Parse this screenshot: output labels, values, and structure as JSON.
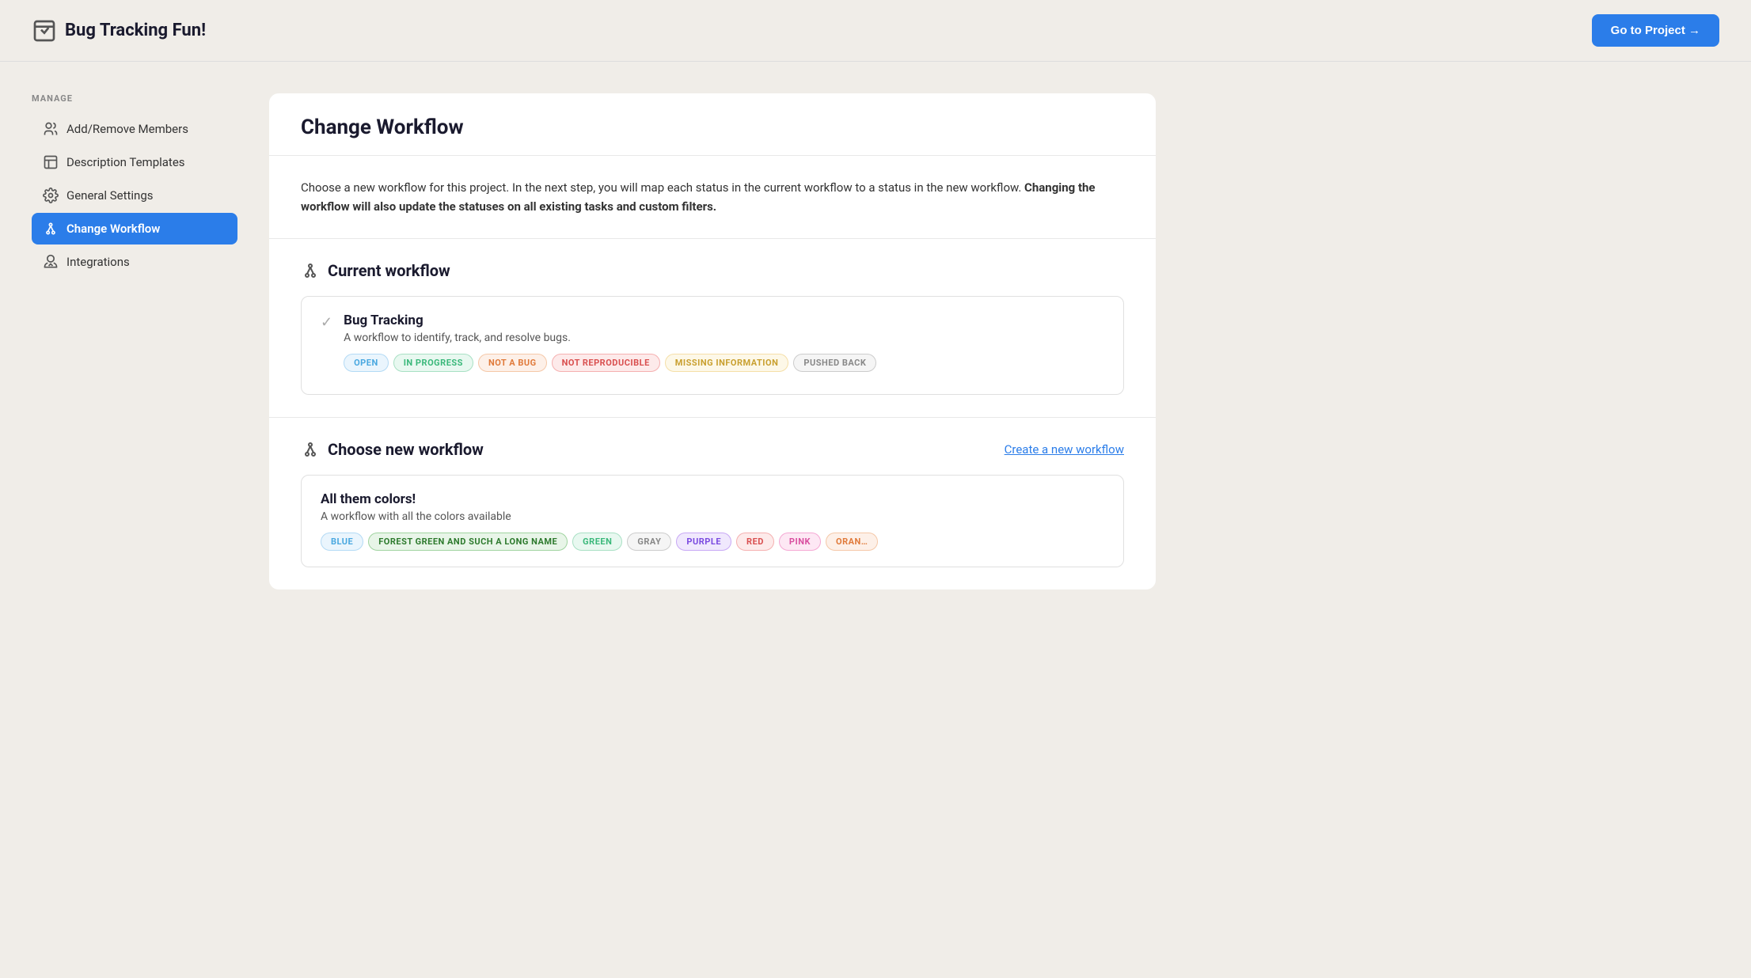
{
  "header": {
    "title": "Bug Tracking Fun!",
    "go_to_project_label": "Go to Project →"
  },
  "sidebar": {
    "section_label": "MANAGE",
    "items": [
      {
        "id": "add-remove-members",
        "label": "Add/Remove Members",
        "icon": "people",
        "active": false
      },
      {
        "id": "description-templates",
        "label": "Description Templates",
        "icon": "template",
        "active": false
      },
      {
        "id": "general-settings",
        "label": "General Settings",
        "icon": "gear",
        "active": false
      },
      {
        "id": "change-workflow",
        "label": "Change Workflow",
        "icon": "workflow",
        "active": true
      },
      {
        "id": "integrations",
        "label": "Integrations",
        "icon": "gear2",
        "active": false
      }
    ]
  },
  "main": {
    "page_title": "Change Workflow",
    "description": "Choose a new workflow for this project. In the next step, you will map each status in the current workflow to a status in the new workflow.",
    "description_bold": "Changing the workflow will also update the statuses on all existing tasks and custom filters.",
    "current_workflow": {
      "section_title": "Current workflow",
      "card": {
        "name": "Bug Tracking",
        "description": "A workflow to identify, track, and resolve bugs.",
        "tags": [
          {
            "label": "OPEN",
            "style": "blue"
          },
          {
            "label": "IN PROGRESS",
            "style": "green"
          },
          {
            "label": "NOT A BUG",
            "style": "orange"
          },
          {
            "label": "NOT REPRODUCIBLE",
            "style": "red"
          },
          {
            "label": "MISSING INFORMATION",
            "style": "yellow"
          },
          {
            "label": "PUSHED BACK",
            "style": "gray"
          }
        ]
      }
    },
    "choose_workflow": {
      "section_title": "Choose new workflow",
      "create_link": "Create a new workflow",
      "card": {
        "name": "All them colors!",
        "description": "A workflow with all the colors available",
        "tags": [
          {
            "label": "BLUE",
            "style": "blue"
          },
          {
            "label": "FOREST GREEN AND SUCH A LONG NAME",
            "style": "forest"
          },
          {
            "label": "GREEN",
            "style": "green"
          },
          {
            "label": "GRAY",
            "style": "gray"
          },
          {
            "label": "PURPLE",
            "style": "purple"
          },
          {
            "label": "RED",
            "style": "red"
          },
          {
            "label": "PINK",
            "style": "pink"
          },
          {
            "label": "ORANGE",
            "style": "orange"
          }
        ]
      }
    }
  }
}
